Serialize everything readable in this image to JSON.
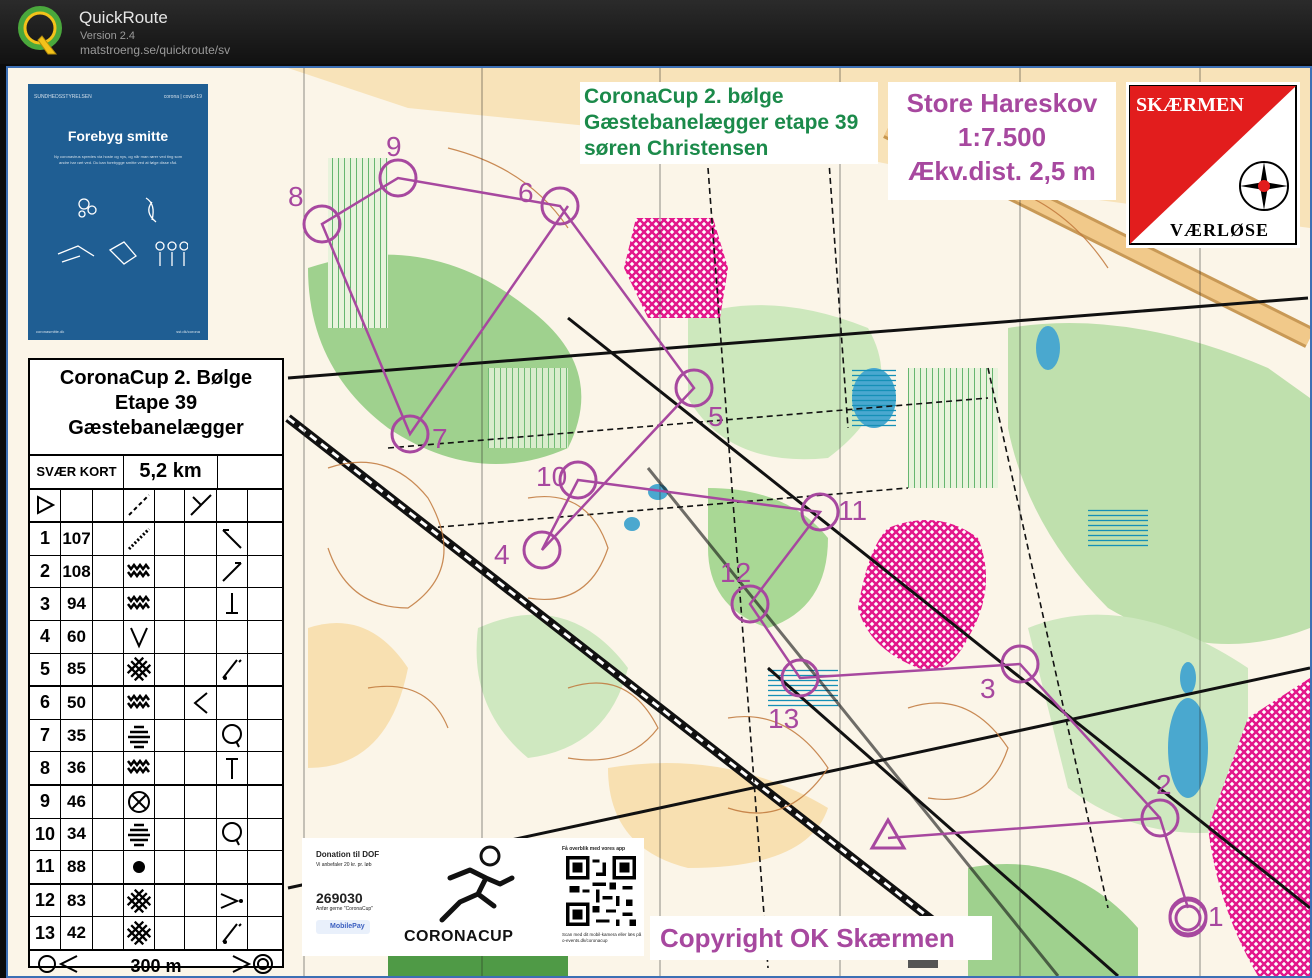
{
  "app": {
    "name": "QuickRoute",
    "version": "Version 2.4",
    "url": "matstroeng.se/quickroute/sv",
    "logo_letter": "Q"
  },
  "map": {
    "race_title": [
      "CoronaCup 2. bølge",
      "Gæstebanelægger etape 39",
      "søren Christensen"
    ],
    "map_title": [
      "Store Hareskov",
      "1:7.500",
      "Ækv.dist. 2,5 m"
    ],
    "club_logo": {
      "top": "SKÆRMEN",
      "bottom": "VÆRLØSE"
    },
    "copyright": "Copyright OK Skærmen",
    "course_color": "#a7489f",
    "control_numbers": [
      "1",
      "2",
      "3",
      "4",
      "5",
      "6",
      "7",
      "8",
      "9",
      "10",
      "11",
      "12",
      "13"
    ]
  },
  "poster": {
    "agency": "SUNDHEDSSTYRELSEN",
    "brand": "corona | covid-19",
    "title": "Forebyg smitte",
    "body": "Ny coronavirus spredes via hoste og nys, og når man rører ved ting som andre har rørt ved. Du kan forebygge smitte ved at følge disse råd.",
    "foot_left": "coronasmitte.dk",
    "foot_right": "sst.dk/corona"
  },
  "control_description": {
    "header": [
      "CoronaCup 2. Bølge",
      "Etape 39",
      "Gæstebanelægger"
    ],
    "class": "SVÆR KORT",
    "distance": "5,2 km",
    "rows": [
      {
        "n": "1",
        "code": "107",
        "feature": "dotted-line",
        "pos": "",
        "extra": "corner-left"
      },
      {
        "n": "2",
        "code": "108",
        "feature": "ruin-zigzag",
        "pos": "",
        "extra": "slash"
      },
      {
        "n": "3",
        "code": "94",
        "feature": "ruin-zigzag",
        "pos": "",
        "extra": "foot"
      },
      {
        "n": "4",
        "code": "60",
        "feature": "v-shape",
        "pos": "",
        "extra": ""
      },
      {
        "n": "5",
        "code": "85",
        "feature": "vegetation-cross",
        "pos": "",
        "extra": "tree-foot"
      },
      {
        "n": "6",
        "code": "50",
        "feature": "ruin-zigzag",
        "pos": "lt",
        "extra": ""
      },
      {
        "n": "7",
        "code": "35",
        "feature": "marsh",
        "pos": "",
        "extra": "o-open"
      },
      {
        "n": "8",
        "code": "36",
        "feature": "ruin-zigzag",
        "pos": "",
        "extra": "top-bar"
      },
      {
        "n": "9",
        "code": "46",
        "feature": "circle-x",
        "pos": "",
        "extra": ""
      },
      {
        "n": "10",
        "code": "34",
        "feature": "marsh",
        "pos": "",
        "extra": "o-open"
      },
      {
        "n": "11",
        "code": "88",
        "feature": "dot",
        "pos": "",
        "extra": ""
      },
      {
        "n": "12",
        "code": "83",
        "feature": "vegetation-cross",
        "pos": "",
        "extra": "arrow-dot"
      },
      {
        "n": "13",
        "code": "42",
        "feature": "vegetation-cross",
        "pos": "",
        "extra": "tree-foot"
      }
    ],
    "footer": "300 m"
  },
  "donation": {
    "title": "Donation til DOF",
    "line1": "Vi anbefaler 20 kr. pr. løb",
    "number": "269030",
    "line2": "Anfør gerne \"CoronaCup\"",
    "mobilepay": "MobilePay",
    "brand": "CORONACUP",
    "qr_head": "Få overblik med vores app",
    "qr_foot": "Scan med dit mobil-kamera eller læs på o-events.dk/coronacup"
  }
}
